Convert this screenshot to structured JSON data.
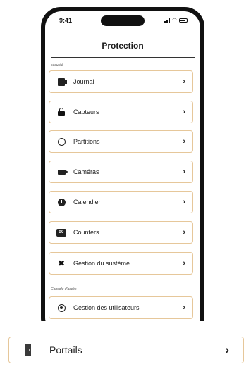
{
  "status_bar": {
    "time": "9:41"
  },
  "header": {
    "title": "Protection"
  },
  "sections": {
    "security_label": "sécurité",
    "console_label": "Console d'accès"
  },
  "menu": {
    "items": [
      {
        "label": "Journal",
        "icon": "journal-icon"
      },
      {
        "label": "Capteurs",
        "icon": "lock-icon"
      },
      {
        "label": "Partitions",
        "icon": "circle-icon"
      },
      {
        "label": "Caméras",
        "icon": "camera-icon"
      },
      {
        "label": "Calendier",
        "icon": "clock-icon"
      },
      {
        "label": "Counters",
        "icon": "counter-icon"
      },
      {
        "label": "Gestion du sustème",
        "icon": "tools-icon"
      },
      {
        "label": "Gestion des utilisateurs",
        "icon": "user-circle-icon"
      }
    ],
    "chevron": "›",
    "counter_icon_text": "00"
  },
  "callout": {
    "label": "Portails",
    "icon": "door-icon",
    "chevron": "›"
  },
  "colors": {
    "item_border": "#e6c79a",
    "phone_frame": "#111111"
  }
}
